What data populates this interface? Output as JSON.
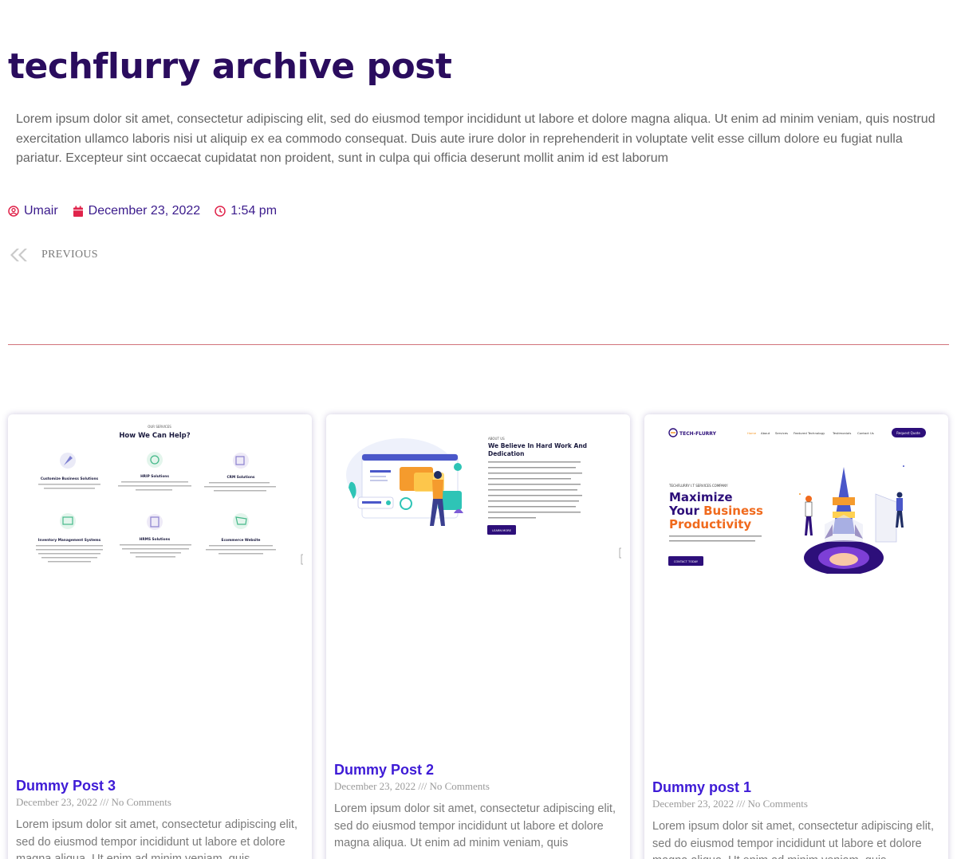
{
  "page": {
    "title": "techflurry archive post",
    "intro": "Lorem ipsum dolor sit amet, consectetur adipiscing elit, sed do eiusmod tempor incididunt ut labore et dolore magna aliqua. Ut enim ad minim veniam, quis nostrud exercitation ullamco laboris nisi ut aliquip ex ea commodo consequat. Duis aute irure dolor in reprehenderit in voluptate velit esse cillum dolore eu fugiat nulla pariatur. Excepteur sint occaecat cupidatat non proident, sunt in culpa qui officia deserunt mollit anim id est laborum"
  },
  "meta": {
    "author": "Umair",
    "date": "December 23, 2022",
    "time": "1:54 pm"
  },
  "navigation": {
    "previous_label": "PREVIOUS"
  },
  "posts": [
    {
      "title": "Dummy Post 3",
      "meta": "December 23, 2022 /// No Comments",
      "excerpt": "Lorem ipsum dolor sit amet, consectetur adipiscing elit, sed do eiusmod tempor incididunt ut labore et dolore magna aliqua. Ut enim ad minim veniam, quis",
      "thumbnail": {
        "eyebrow": "OUR SERVICES",
        "heading": "How We Can Help?",
        "services": [
          "Customize Business Solutions",
          "HRIP Solutions",
          "CRM Solutions",
          "Inventory Management Systems",
          "HRMS Solutions",
          "Ecommerce Website"
        ]
      }
    },
    {
      "title": "Dummy Post 2",
      "meta": "December 23, 2022 /// No Comments",
      "excerpt": "Lorem ipsum dolor sit amet, consectetur adipiscing elit, sed do eiusmod tempor incididunt ut labore et dolore magna aliqua. Ut enim ad minim veniam, quis",
      "thumbnail": {
        "eyebrow": "ABOUT US",
        "heading": "We Believe In Hard Work And Dedication",
        "button": "LEARN MORE"
      }
    },
    {
      "title": "Dummy post 1",
      "meta": "December 23, 2022 /// No Comments",
      "excerpt": "Lorem ipsum dolor sit amet, consectetur adipiscing elit, sed do eiusmod tempor incididunt ut labore et dolore magna aliqua. Ut enim ad minim veniam, quis",
      "thumbnail": {
        "logo": "TECH-FLURRY",
        "nav": [
          "Home",
          "About",
          "Services",
          "Featured Technology",
          "Testimonials",
          "Contact Us"
        ],
        "cta": "Request Quote",
        "eyebrow": "TECHFLURRY I.T SERVICES COMPANY",
        "headline_1": "Maximize",
        "headline_2a": "Your ",
        "headline_2b": "Business",
        "headline_3": "Productivity",
        "button": "CONTACT TODAY"
      }
    }
  ],
  "colors": {
    "title": "#2a0c5e",
    "accent": "#3e1bd6",
    "meta_icon": "#e0244b",
    "divider": "#d2737a"
  }
}
